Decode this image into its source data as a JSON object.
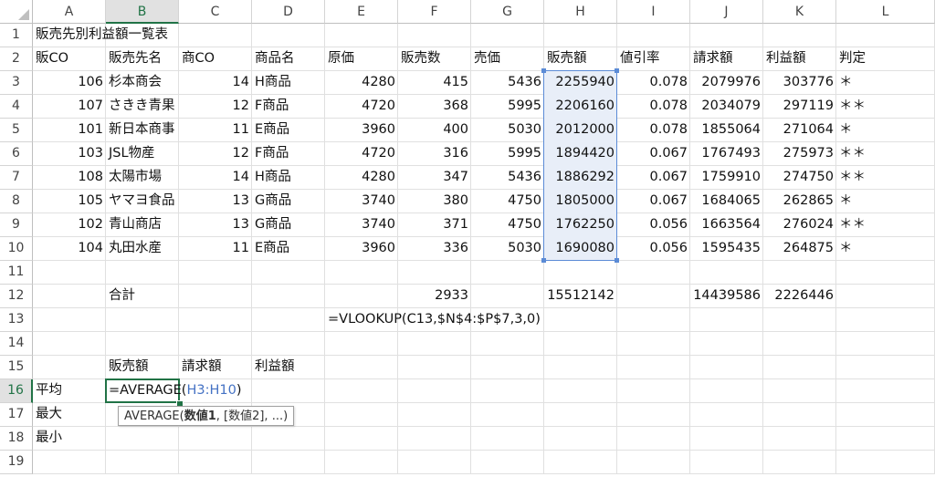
{
  "columns": [
    "A",
    "B",
    "C",
    "D",
    "E",
    "F",
    "G",
    "H",
    "I",
    "J",
    "K",
    "L"
  ],
  "active_column": "B",
  "rows": [
    "1",
    "2",
    "3",
    "4",
    "5",
    "6",
    "7",
    "8",
    "9",
    "10",
    "11",
    "12",
    "13",
    "14",
    "15",
    "16",
    "17",
    "18",
    "19"
  ],
  "active_row": "16",
  "title": "販売先別利益額一覧表",
  "headers": [
    "販CO",
    "販売先名",
    "商CO",
    "商品名",
    "原価",
    "販売数",
    "売価",
    "販売額",
    "値引率",
    "請求額",
    "利益額",
    "判定"
  ],
  "data_rows": [
    [
      "106",
      "杉本商会",
      "14",
      "H商品",
      "4280",
      "415",
      "5436",
      "2255940",
      "0.078",
      "2079976",
      "303776",
      "＊"
    ],
    [
      "107",
      "さきき青果",
      "12",
      "F商品",
      "4720",
      "368",
      "5995",
      "2206160",
      "0.078",
      "2034079",
      "297119",
      "＊＊"
    ],
    [
      "101",
      "新日本商事",
      "11",
      "E商品",
      "3960",
      "400",
      "5030",
      "2012000",
      "0.078",
      "1855064",
      "271064",
      "＊"
    ],
    [
      "103",
      "JSL物産",
      "12",
      "F商品",
      "4720",
      "316",
      "5995",
      "1894420",
      "0.067",
      "1767493",
      "275973",
      "＊＊"
    ],
    [
      "108",
      "太陽市場",
      "14",
      "H商品",
      "4280",
      "347",
      "5436",
      "1886292",
      "0.067",
      "1759910",
      "274750",
      "＊＊"
    ],
    [
      "105",
      "ヤマヨ食品",
      "13",
      "G商品",
      "3740",
      "380",
      "4750",
      "1805000",
      "0.067",
      "1684065",
      "262865",
      "＊"
    ],
    [
      "102",
      "青山商店",
      "13",
      "G商品",
      "3740",
      "371",
      "4750",
      "1762250",
      "0.056",
      "1663564",
      "276024",
      "＊＊"
    ],
    [
      "104",
      "丸田水産",
      "11",
      "E商品",
      "3960",
      "336",
      "5030",
      "1690080",
      "0.056",
      "1595435",
      "264875",
      "＊"
    ]
  ],
  "totals": {
    "label": "合計",
    "qty": "2933",
    "sales": "15512142",
    "billed": "14439586",
    "profit": "2226446"
  },
  "e13_formula": "=VLOOKUP(C13,$N$4:$P$7,3,0)",
  "row15": {
    "sales": "販売額",
    "billed": "請求額",
    "profit": "利益額"
  },
  "row_labels": {
    "avg": "平均",
    "max": "最大",
    "min": "最小"
  },
  "active_formula": {
    "prefix": "=AVERAGE(",
    "ref": "H3:H10",
    "suffix": ")"
  },
  "tooltip": {
    "fn": "AVERAGE(",
    "arg1": "数値1",
    "rest": ", [数値2], ...)"
  }
}
